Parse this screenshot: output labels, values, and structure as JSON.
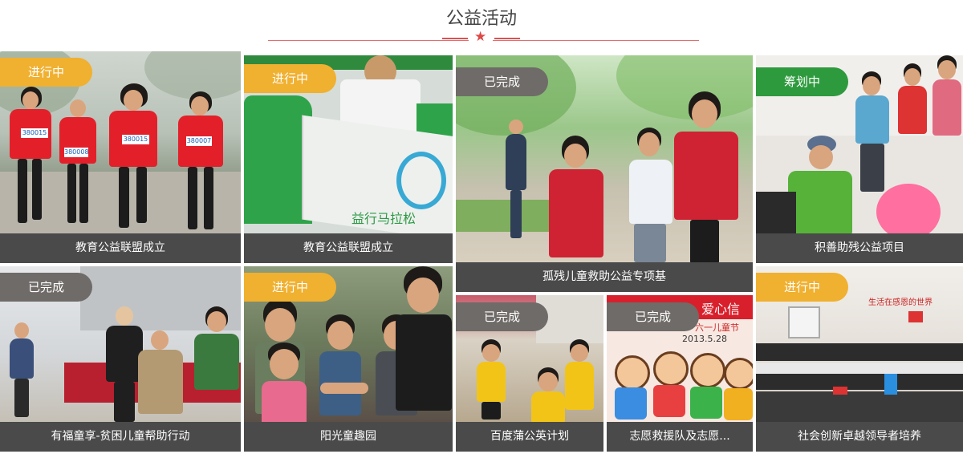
{
  "section": {
    "title": "公益活动",
    "colors": {
      "line": "#e07070",
      "star": "#e04848",
      "caption_bg": "#4a4a4a"
    }
  },
  "status_colors": {
    "进行中": "#f0b030",
    "已完成": "#6f6b68",
    "筹划中": "#2e9a3e"
  },
  "cards": [
    {
      "status": "进行中",
      "caption": "教育公益联盟成立"
    },
    {
      "status": "进行中",
      "caption": "教育公益联盟成立"
    },
    {
      "status": "已完成",
      "caption": "孤残儿童救助公益专项基"
    },
    {
      "status": "筹划中",
      "caption": "积善助残公益项目"
    },
    {
      "status": "已完成",
      "caption": "有福童享-贫困儿童帮助行动"
    },
    {
      "status": "进行中",
      "caption": "阳光童趣园"
    },
    {
      "status": "已完成",
      "caption": "百度蒲公英计划"
    },
    {
      "status": "已完成",
      "caption": "志愿救援队及志愿..."
    },
    {
      "status": "进行中",
      "caption": "社会创新卓越领导者培养"
    }
  ],
  "photo_text": {
    "bibs": [
      "380015",
      "380008",
      "380007"
    ],
    "banner_text": "益行马拉松",
    "poster_text": "爱心信",
    "poster_subtitle": "六一儿童节",
    "poster_date": "2013.5.28",
    "wall_slogan": "生活在感恩的世界"
  }
}
